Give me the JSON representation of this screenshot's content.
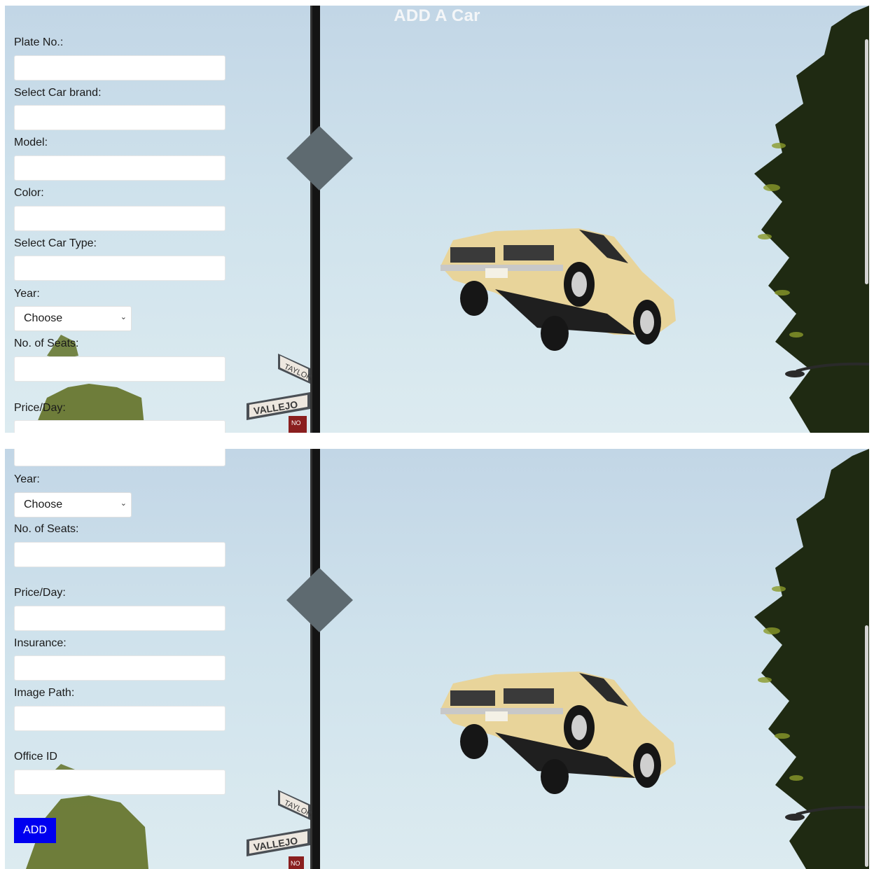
{
  "title": "ADD A Car",
  "fields": {
    "plate": {
      "label": "Plate No.:",
      "value": ""
    },
    "brand": {
      "label": "Select Car brand:",
      "value": ""
    },
    "model": {
      "label": "Model:",
      "value": ""
    },
    "color": {
      "label": "Color:",
      "value": ""
    },
    "type": {
      "label": "Select Car Type:",
      "value": ""
    },
    "year": {
      "label": "Year:",
      "selected": "Choose"
    },
    "seats": {
      "label": "No. of Seats:",
      "value": ""
    },
    "price": {
      "label": "Price/Day:",
      "value": ""
    },
    "insurance": {
      "label": "Insurance:",
      "value": ""
    },
    "image_path": {
      "label": "Image Path:",
      "value": ""
    },
    "office_id": {
      "label": "Office ID",
      "value": ""
    }
  },
  "add_button": "ADD",
  "background": {
    "signs": {
      "taylor": "TAYLOR",
      "vallejo": "VALLEJO",
      "no": "NO"
    }
  },
  "colors": {
    "button": "#0000f0",
    "sky": "#cfe2ec",
    "car": "#e8d49a"
  }
}
